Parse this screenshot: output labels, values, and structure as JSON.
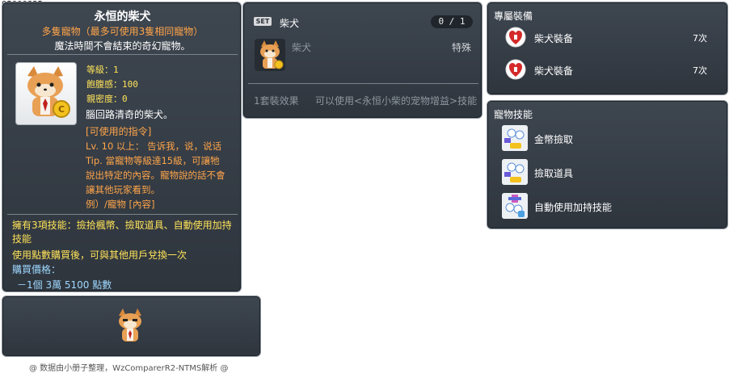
{
  "item": {
    "id": "05000835",
    "name": "永恒的柴犬",
    "subtitle": "多隻寵物（最多可使用3隻相同寵物）",
    "description": "魔法時間不會結束的奇幻寵物。",
    "stats": {
      "level": "等級：1",
      "fullness": "飽腹感：100",
      "closeness": "親密度：0"
    },
    "desc2": "腦回路清奇的柴犬。",
    "command_header": "[可使用的指令]",
    "commands": [
      "Lv. 10 以上： 告诉我，说，说话",
      "Tip. 當寵物等級達15級，可讓牠",
      "說出特定的內容。寵物說的話不會",
      "讓其他玩家看到。",
      "例）/寵物 [內容]"
    ],
    "skills_line": "擁有3項技能：撿拾楓幣、撿取道具、自動使用加持技能",
    "trade_line": "使用點數購買後，可與其他用戶兌換一次",
    "price_label": "購買價格：",
    "price": "－1個 3萬 5100 點數"
  },
  "credit": "@ 数据由小册子整理，WzComparerR2-NTMS解析 @",
  "set_panel": {
    "badge": "SET",
    "name": "柴犬",
    "count": "0 / 1",
    "item_name": "柴犬",
    "item_type": "特殊",
    "effect_label": "1套裝效果",
    "effect_text": "可以使用<永恒小柴的宠物增益>技能"
  },
  "equip_panel": {
    "title": "專屬裝備",
    "items": [
      {
        "name": "柴犬裝备",
        "count": "7次"
      },
      {
        "name": "柴犬裝备",
        "count": "7次"
      }
    ]
  },
  "skill_panel": {
    "title": "寵物技能",
    "skills": [
      {
        "name": "金幣撿取",
        "icon": "coin-pickup-icon"
      },
      {
        "name": "撿取道具",
        "icon": "item-pickup-icon"
      },
      {
        "name": "自動使用加持技能",
        "icon": "auto-buff-icon"
      }
    ]
  },
  "colors": {
    "panel_bg": "#343b43",
    "orange": "#ffa54a",
    "yellow": "#ffe35a",
    "blue": "#9fd8ff"
  }
}
